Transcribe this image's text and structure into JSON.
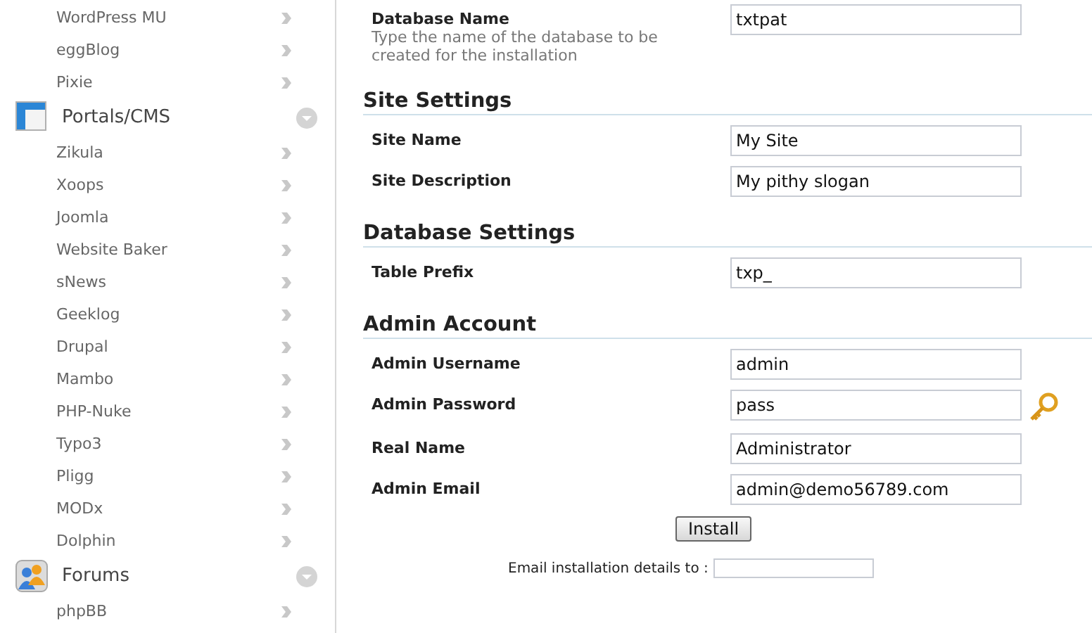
{
  "sidebar": {
    "entries": [
      {
        "kind": "item",
        "label": "WordPress MU"
      },
      {
        "kind": "item",
        "label": "eggBlog"
      },
      {
        "kind": "item",
        "label": "Pixie"
      },
      {
        "kind": "category",
        "label": "Portals/CMS"
      },
      {
        "kind": "item",
        "label": "Zikula"
      },
      {
        "kind": "item",
        "label": "Xoops"
      },
      {
        "kind": "item",
        "label": "Joomla"
      },
      {
        "kind": "item",
        "label": "Website Baker"
      },
      {
        "kind": "item",
        "label": "sNews"
      },
      {
        "kind": "item",
        "label": "Geeklog"
      },
      {
        "kind": "item",
        "label": "Drupal"
      },
      {
        "kind": "item",
        "label": "Mambo"
      },
      {
        "kind": "item",
        "label": "PHP-Nuke"
      },
      {
        "kind": "item",
        "label": "Typo3"
      },
      {
        "kind": "item",
        "label": "Pligg"
      },
      {
        "kind": "item",
        "label": "MODx"
      },
      {
        "kind": "item",
        "label": "Dolphin"
      },
      {
        "kind": "category",
        "label": "Forums"
      },
      {
        "kind": "item",
        "label": "phpBB"
      }
    ]
  },
  "form": {
    "sections": [
      {
        "fields": [
          {
            "kind": "text",
            "label": "Database Name",
            "hint": "Type the name of the database to be created for the installation",
            "value": "txtpat"
          }
        ]
      },
      {
        "heading": "Site Settings",
        "fields": [
          {
            "kind": "text",
            "label": "Site Name",
            "value": "My Site"
          },
          {
            "kind": "text",
            "label": "Site Description",
            "value": "My pithy slogan"
          }
        ]
      },
      {
        "heading": "Database Settings",
        "fields": [
          {
            "kind": "text",
            "label": "Table Prefix",
            "value": "txp_"
          }
        ]
      },
      {
        "heading": "Admin Account",
        "fields": [
          {
            "kind": "text",
            "label": "Admin Username",
            "value": "admin"
          },
          {
            "kind": "password",
            "label": "Admin Password",
            "value": "pass"
          },
          {
            "kind": "text",
            "label": "Real Name",
            "value": "Administrator"
          },
          {
            "kind": "text",
            "label": "Admin Email",
            "value": "admin@demo56789.com"
          }
        ]
      }
    ],
    "install_button": "Install",
    "email_details": {
      "label": "Email installation details to :"
    }
  }
}
